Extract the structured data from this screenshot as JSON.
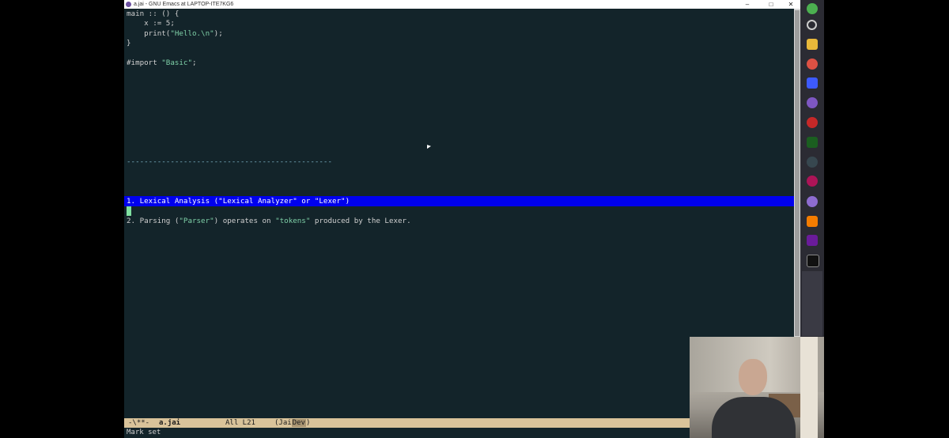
{
  "window": {
    "title": "a.jai - GNU Emacs at LAPTOP-ITE7KG6",
    "minimize": "–",
    "maximize": "□",
    "close": "✕"
  },
  "code": {
    "l1": "main :: () {",
    "l2": "    x := 5;",
    "l3a": "    print(",
    "l3b": "\"Hello.\\n\"",
    "l3c": ");",
    "l4": "}",
    "l5a": "#import ",
    "l5b": "\"Basic\"",
    "l5c": ";",
    "separator": "-----------------------------------------------",
    "item1": "1. Lexical Analysis (\"Lexical Analyzer\" or \"Lexer\")",
    "item2a": "2. Parsing (",
    "item2b": "\"Parser\"",
    "item2c": ") operates on ",
    "item2d": "\"tokens\"",
    "item2e": " produced by the Lexer."
  },
  "modeline": {
    "status": "-\\**-",
    "buffer": "a.jai",
    "position": "All L21",
    "mode_open": "(Jai",
    "mode_dim": "Dev",
    "mode_close": ")"
  },
  "minibuffer": {
    "message": "Mark set"
  },
  "taskbar": {
    "icons": [
      "grid-icon",
      "search-icon",
      "folder-icon",
      "chrome-icon",
      "app-icon",
      "emacs-icon",
      "app-icon",
      "terminal-icon",
      "circle-icon",
      "app-icon",
      "emacs-icon",
      "vlc-icon",
      "visual-studio-icon",
      "console-icon"
    ]
  },
  "colors": {
    "background": "#13242a",
    "highlight": "#0000ee",
    "string": "#7fd1a8",
    "modeline": "#d9c39a"
  }
}
